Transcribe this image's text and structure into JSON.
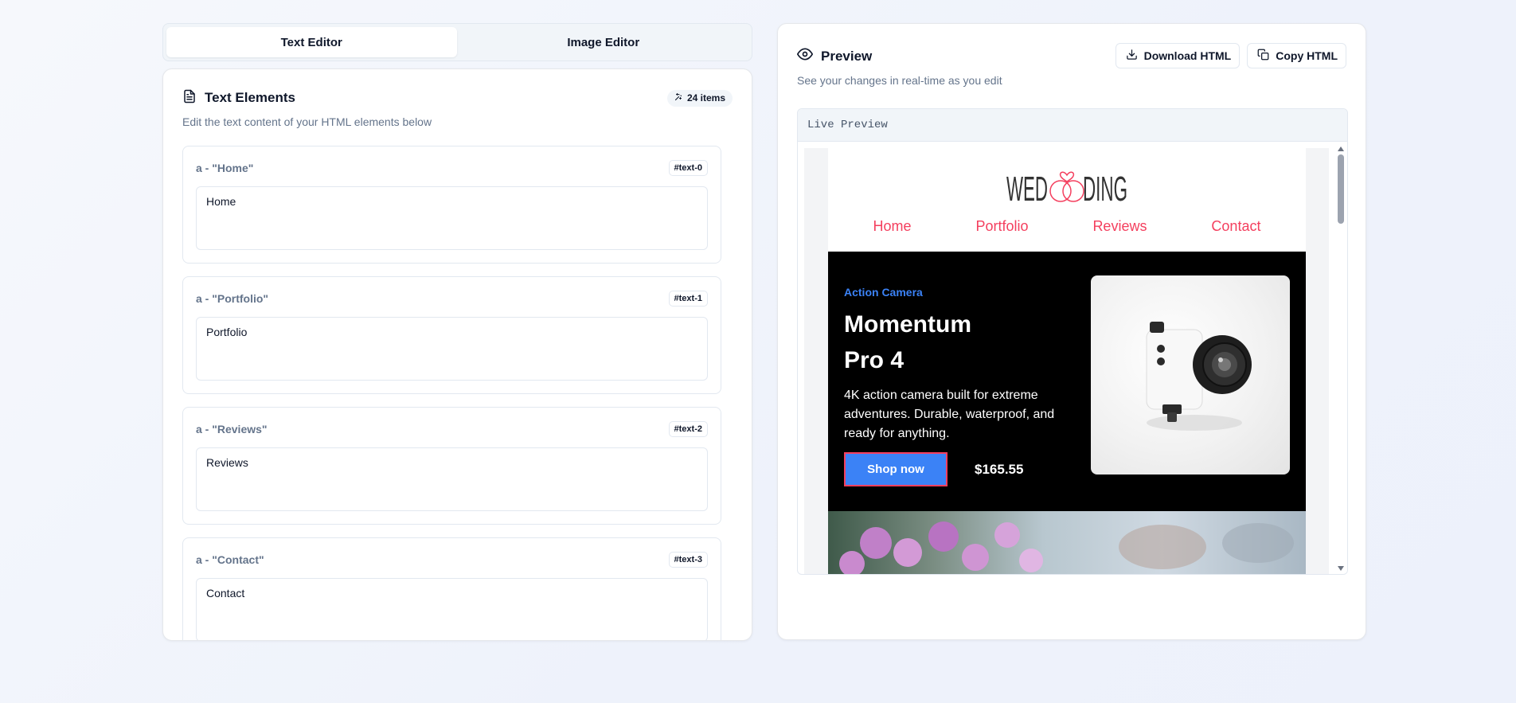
{
  "tabs": [
    {
      "label": "Text Editor",
      "active": true
    },
    {
      "label": "Image Editor",
      "active": false
    }
  ],
  "editor": {
    "title": "Text Elements",
    "subtitle": "Edit the text content of your HTML elements below",
    "count": "24 items",
    "items": [
      {
        "label": "a - \"Home\"",
        "id": "#text-0",
        "value": "Home"
      },
      {
        "label": "a - \"Portfolio\"",
        "id": "#text-1",
        "value": "Portfolio"
      },
      {
        "label": "a - \"Reviews\"",
        "id": "#text-2",
        "value": "Reviews"
      },
      {
        "label": "a - \"Contact\"",
        "id": "#text-3",
        "value": "Contact"
      }
    ]
  },
  "preview": {
    "title": "Preview",
    "subtitle": "See your changes in real-time as you edit",
    "download_label": "Download HTML",
    "copy_label": "Copy HTML",
    "live_label": "Live Preview",
    "email": {
      "logo_left": "WED",
      "logo_right": "DING",
      "nav": [
        "Home",
        "Portfolio",
        "Reviews",
        "Contact"
      ],
      "hero": {
        "tag": "Action Camera",
        "title_line1": "Momentum",
        "title_line2": "Pro 4",
        "description": "4K action camera built for extreme adventures. Durable, waterproof, and ready for anything.",
        "cta": "Shop now",
        "price": "$165.55"
      }
    }
  },
  "colors": {
    "accent_pink": "#f43f5e",
    "accent_blue": "#3b82f6",
    "muted_text": "#64748b"
  },
  "icons": {
    "document": "document-icon",
    "sparkle": "sparkle-icon",
    "eye": "eye-icon",
    "download": "download-icon",
    "copy": "copy-icon"
  }
}
